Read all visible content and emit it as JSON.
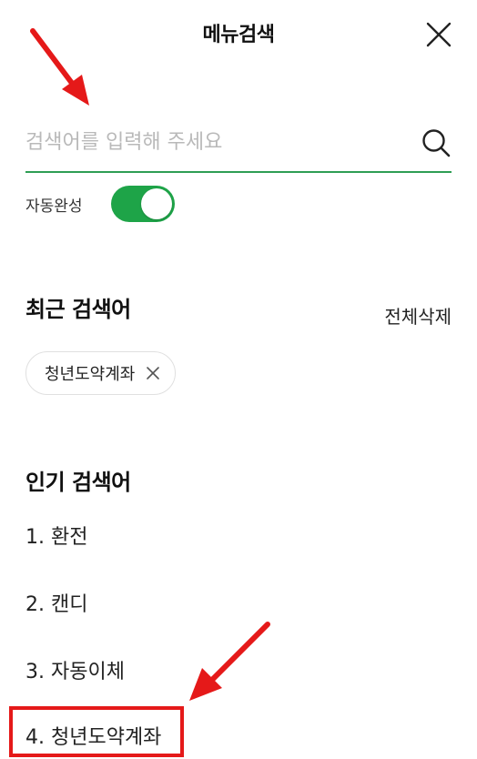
{
  "header": {
    "title": "메뉴검색"
  },
  "search": {
    "placeholder": "검색어를 입력해 주세요",
    "value": ""
  },
  "autocomplete": {
    "label": "자동완성",
    "enabled": true
  },
  "recent": {
    "title": "최근 검색어",
    "delete_all_label": "전체삭제",
    "items": [
      {
        "label": "청년도약계좌"
      }
    ]
  },
  "popular": {
    "title": "인기 검색어",
    "items": [
      {
        "label": "1. 환전"
      },
      {
        "label": "2. 캔디"
      },
      {
        "label": "3. 자동이체"
      },
      {
        "label": "4. 청년도약계좌"
      }
    ]
  },
  "icons": {
    "close": "close-icon",
    "search": "search-icon",
    "chip_remove": "close-icon",
    "annotation_arrow": "red-arrow"
  },
  "colors": {
    "accent_green": "#2e9e54",
    "toggle_on": "#1ea448",
    "annotation_red": "#e51919"
  }
}
